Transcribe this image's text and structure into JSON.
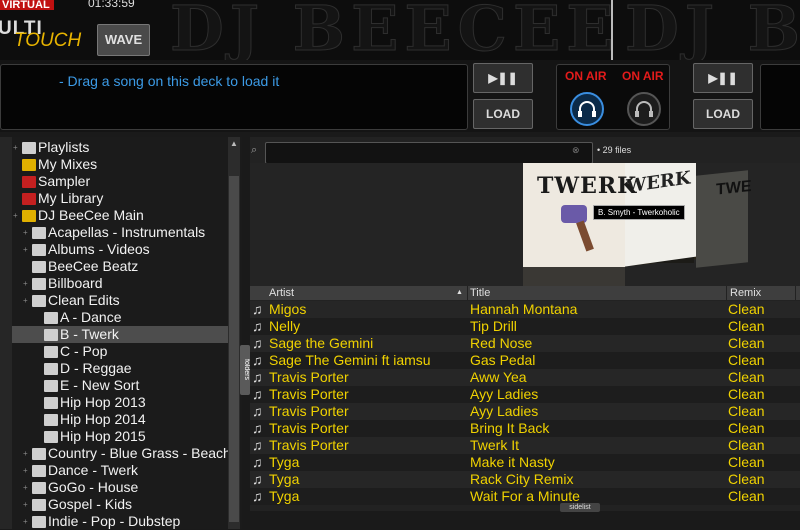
{
  "header": {
    "logo_text": "VIRTUAL DJ",
    "clock": "01:33:59",
    "multi": "ULTI",
    "touch": "TOUCH",
    "wave_button": "WAVE",
    "background_brand": "DJ BEECEE"
  },
  "deck_left": {
    "message": "- Drag a song on this deck to load it",
    "play_pause_icon": "play-pause-icon",
    "load_label": "LOAD"
  },
  "mixer": {
    "on_air_left": "ON AIR",
    "on_air_right": "ON AIR",
    "headphone_icon": "headphones-icon",
    "active_color": "#3a8ee0",
    "onair_color": "#e41b1b"
  },
  "deck_right": {
    "play_pause_icon": "play-pause-icon",
    "load_label": "LOAD"
  },
  "tree": {
    "items": [
      {
        "label": "Playlists",
        "icon": "playlist-icon",
        "color": "gray"
      },
      {
        "label": "My Mixes",
        "icon": "star-folder-icon",
        "color": "yellow"
      },
      {
        "label": "Sampler",
        "icon": "sampler-icon",
        "color": "red"
      },
      {
        "label": "My Library",
        "icon": "library-icon",
        "color": "red"
      },
      {
        "label": "DJ BeeCee Main",
        "icon": "star-folder-icon",
        "color": "yellow"
      },
      {
        "label": "Acapellas - Instrumentals",
        "icon": "folder-icon",
        "color": "gray"
      },
      {
        "label": "Albums - Videos",
        "icon": "folder-icon",
        "color": "gray"
      },
      {
        "label": "BeeCee Beatz",
        "icon": "folder-icon",
        "color": "gray"
      },
      {
        "label": "Billboard",
        "icon": "folder-icon",
        "color": "gray"
      },
      {
        "label": "Clean Edits",
        "icon": "folder-icon",
        "color": "gray"
      },
      {
        "label": "A - Dance",
        "icon": "folder-icon",
        "color": "gray"
      },
      {
        "label": "B - Twerk",
        "icon": "folder-icon",
        "color": "gray"
      },
      {
        "label": "C - Pop",
        "icon": "folder-icon",
        "color": "gray"
      },
      {
        "label": "D - Reggae",
        "icon": "folder-icon",
        "color": "gray"
      },
      {
        "label": "E - New Sort",
        "icon": "folder-icon",
        "color": "gray"
      },
      {
        "label": "Hip Hop 2013",
        "icon": "folder-icon",
        "color": "gray"
      },
      {
        "label": "Hip Hop 2014",
        "icon": "folder-icon",
        "color": "gray"
      },
      {
        "label": "Hip Hop 2015",
        "icon": "folder-icon",
        "color": "gray"
      },
      {
        "label": "Country - Blue Grass - Beach",
        "icon": "folder-icon",
        "color": "gray"
      },
      {
        "label": "Dance - Twerk",
        "icon": "folder-icon",
        "color": "gray"
      },
      {
        "label": "GoGo - House",
        "icon": "folder-icon",
        "color": "gray"
      },
      {
        "label": "Gospel - Kids",
        "icon": "folder-icon",
        "color": "gray"
      },
      {
        "label": "Indie - Pop - Dubstep",
        "icon": "folder-icon",
        "color": "gray"
      }
    ],
    "folders_tab": "folders"
  },
  "browser": {
    "search_value": "",
    "file_count": "29 files",
    "cover_text_main": "TWERK",
    "cover_text_2": "WERK",
    "cover_text_3": "TWE",
    "tooltip": "B. Smyth - Twerkoholic",
    "columns": [
      "Artist",
      "Title",
      "Remix"
    ],
    "rows": [
      {
        "artist": "Migos",
        "title": "Hannah Montana",
        "remix": "Clean"
      },
      {
        "artist": "Nelly",
        "title": "Tip Drill",
        "remix": "Clean"
      },
      {
        "artist": "Sage the Gemini",
        "title": "Red Nose",
        "remix": "Clean"
      },
      {
        "artist": "Sage The Gemini ft iamsu",
        "title": "Gas Pedal",
        "remix": "Clean"
      },
      {
        "artist": "Travis Porter",
        "title": "Aww Yea",
        "remix": "Clean"
      },
      {
        "artist": "Travis Porter",
        "title": "Ayy Ladies",
        "remix": "Clean"
      },
      {
        "artist": "Travis Porter",
        "title": "Ayy Ladies",
        "remix": "Clean"
      },
      {
        "artist": "Travis Porter",
        "title": "Bring It Back",
        "remix": "Clean"
      },
      {
        "artist": "Travis Porter",
        "title": "Twerk It",
        "remix": "Clean"
      },
      {
        "artist": "Tyga",
        "title": "Make it Nasty",
        "remix": "Clean"
      },
      {
        "artist": "Tyga",
        "title": "Rack City Remix",
        "remix": "Clean"
      },
      {
        "artist": "Tyga",
        "title": "Wait For a Minute",
        "remix": "Clean"
      }
    ],
    "sidelist_label": "sidelist"
  }
}
